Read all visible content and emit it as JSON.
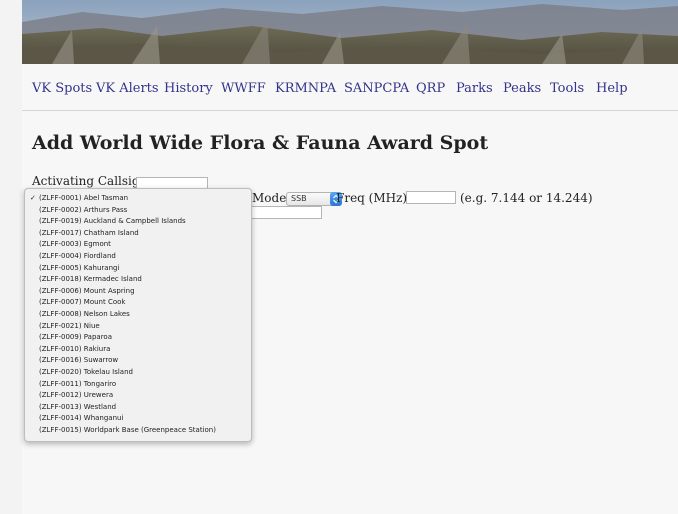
{
  "nav": {
    "items": [
      "VK Spots",
      "VK Alerts",
      "History",
      "WWFF",
      "KRMNPA",
      "SANPCPA",
      "QRP",
      "Parks",
      "Peaks",
      "Tools",
      "Help"
    ]
  },
  "page": {
    "title": "Add World Wide Flora & Fauna Award Spot"
  },
  "form": {
    "activating_callsign_label": "Activating Callsign:",
    "mode_label": "Mode:",
    "mode_value": "SSB",
    "freq_label": "Freq (MHz):",
    "freq_hint": "(e.g. 7.144 or 14.244)"
  },
  "park_dropdown": {
    "selected_index": 0,
    "checkmark": "✓",
    "options": [
      "(ZLFF-0001) Abel Tasman",
      "(ZLFF-0002) Arthurs Pass",
      "(ZLFF-0019) Auckland & Campbell Islands",
      "(ZLFF-0017) Chatham Island",
      "(ZLFF-0003) Egmont",
      "(ZLFF-0004) Fiordland",
      "(ZLFF-0005) Kahurangi",
      "(ZLFF-0018) Kermadec Island",
      "(ZLFF-0006) Mount Aspring",
      "(ZLFF-0007) Mount Cook",
      "(ZLFF-0008) Nelson Lakes",
      "(ZLFF-0021) Niue",
      "(ZLFF-0009) Paparoa",
      "(ZLFF-0010) Rakiura",
      "(ZLFF-0016) Suwarrow",
      "(ZLFF-0020) Tokelau Island",
      "(ZLFF-0011) Tongariro",
      "(ZLFF-0012) Urewera",
      "(ZLFF-0013) Westland",
      "(ZLFF-0014) Whanganui",
      "(ZLFF-0015) Worldpark Base (Greenpeace Station)"
    ]
  },
  "colors": {
    "nav_link": "#33338a",
    "page_bg": "#f7f7f7",
    "select_accent": "#2a76d6"
  },
  "icons": {
    "select_chevron": "chevron-updown-icon"
  }
}
